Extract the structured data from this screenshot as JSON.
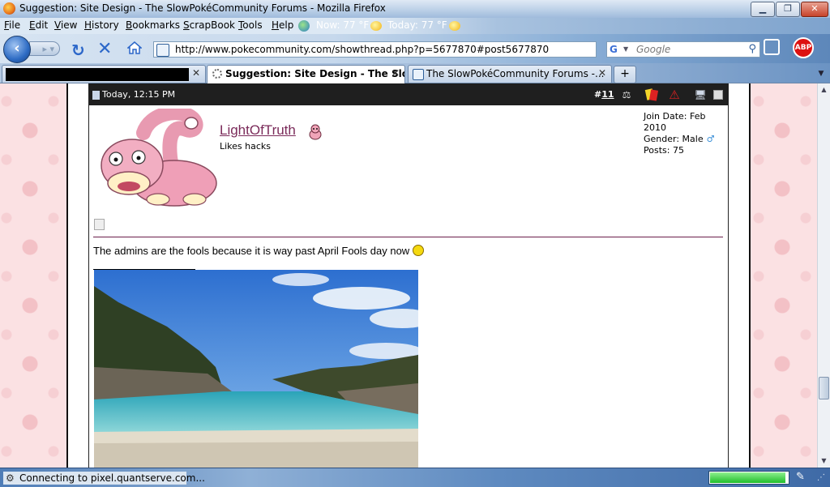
{
  "window": {
    "title": "Suggestion: Site Design - The SlowPokéCommunity Forums - Mozilla Firefox",
    "min_label": "▁",
    "max_label": "❐",
    "close_label": "✕"
  },
  "menu": {
    "items": [
      "File",
      "Edit",
      "View",
      "History",
      "Bookmarks",
      "ScrapBook",
      "Tools",
      "Help"
    ],
    "weather_now": "Now: 77 °F",
    "weather_today": "Today: 77 °F"
  },
  "nav": {
    "url": "http://www.pokecommunity.com/showthread.php?p=5677870#post5677870",
    "search_placeholder": "Google",
    "search_engine_icon": "G",
    "abp_label": "ABP"
  },
  "tabs": [
    {
      "label": "",
      "redacted": true
    },
    {
      "label": "Suggestion: Site Design - The Slo...",
      "active": true,
      "loading": true
    },
    {
      "label": "The SlowPokéCommunity Forums -...",
      "active": false
    }
  ],
  "newtab_label": "+",
  "post": {
    "date": "Today, 12:15 PM",
    "number_prefix": "#",
    "number": "11",
    "username": "LightOfTruth",
    "user_title": "Likes hacks",
    "join_date": "Join Date: Feb 2010",
    "gender": "Gender: Male",
    "gender_icon": "♂",
    "posts": "Posts: 75",
    "body": "The admins are the fools because it is way past April Fools day now"
  },
  "status": {
    "text": "Connecting to pixel.quantserve.com...",
    "progress": 0.97
  },
  "colors": {
    "username": "#7b2b5a",
    "post_header_bg": "#1f1f1f",
    "page_bg": "#fbe1e3",
    "divider": "#6b1e4a"
  },
  "icons": [
    "firefox-icon",
    "back-arrow-icon",
    "forward-arrow-icon",
    "reload-icon",
    "stop-icon",
    "home-icon",
    "rss-icon",
    "bookmark-star-icon",
    "search-magnifier-icon",
    "windows-icon",
    "adblock-icon",
    "scales-icon",
    "report-cards-icon",
    "warning-icon",
    "computer-icon",
    "smiley-icon"
  ]
}
